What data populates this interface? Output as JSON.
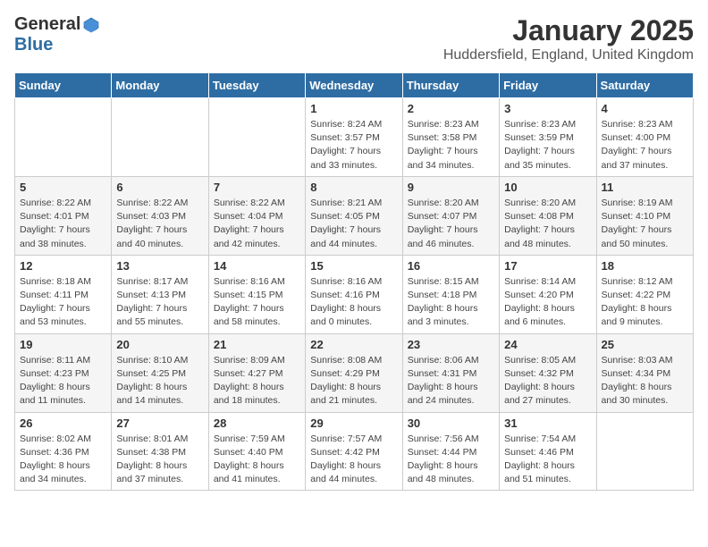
{
  "logo": {
    "general": "General",
    "blue": "Blue"
  },
  "title": {
    "month": "January 2025",
    "location": "Huddersfield, England, United Kingdom"
  },
  "days_of_week": [
    "Sunday",
    "Monday",
    "Tuesday",
    "Wednesday",
    "Thursday",
    "Friday",
    "Saturday"
  ],
  "weeks": [
    [
      {
        "day": "",
        "info": ""
      },
      {
        "day": "",
        "info": ""
      },
      {
        "day": "",
        "info": ""
      },
      {
        "day": "1",
        "info": "Sunrise: 8:24 AM\nSunset: 3:57 PM\nDaylight: 7 hours\nand 33 minutes."
      },
      {
        "day": "2",
        "info": "Sunrise: 8:23 AM\nSunset: 3:58 PM\nDaylight: 7 hours\nand 34 minutes."
      },
      {
        "day": "3",
        "info": "Sunrise: 8:23 AM\nSunset: 3:59 PM\nDaylight: 7 hours\nand 35 minutes."
      },
      {
        "day": "4",
        "info": "Sunrise: 8:23 AM\nSunset: 4:00 PM\nDaylight: 7 hours\nand 37 minutes."
      }
    ],
    [
      {
        "day": "5",
        "info": "Sunrise: 8:22 AM\nSunset: 4:01 PM\nDaylight: 7 hours\nand 38 minutes."
      },
      {
        "day": "6",
        "info": "Sunrise: 8:22 AM\nSunset: 4:03 PM\nDaylight: 7 hours\nand 40 minutes."
      },
      {
        "day": "7",
        "info": "Sunrise: 8:22 AM\nSunset: 4:04 PM\nDaylight: 7 hours\nand 42 minutes."
      },
      {
        "day": "8",
        "info": "Sunrise: 8:21 AM\nSunset: 4:05 PM\nDaylight: 7 hours\nand 44 minutes."
      },
      {
        "day": "9",
        "info": "Sunrise: 8:20 AM\nSunset: 4:07 PM\nDaylight: 7 hours\nand 46 minutes."
      },
      {
        "day": "10",
        "info": "Sunrise: 8:20 AM\nSunset: 4:08 PM\nDaylight: 7 hours\nand 48 minutes."
      },
      {
        "day": "11",
        "info": "Sunrise: 8:19 AM\nSunset: 4:10 PM\nDaylight: 7 hours\nand 50 minutes."
      }
    ],
    [
      {
        "day": "12",
        "info": "Sunrise: 8:18 AM\nSunset: 4:11 PM\nDaylight: 7 hours\nand 53 minutes."
      },
      {
        "day": "13",
        "info": "Sunrise: 8:17 AM\nSunset: 4:13 PM\nDaylight: 7 hours\nand 55 minutes."
      },
      {
        "day": "14",
        "info": "Sunrise: 8:16 AM\nSunset: 4:15 PM\nDaylight: 7 hours\nand 58 minutes."
      },
      {
        "day": "15",
        "info": "Sunrise: 8:16 AM\nSunset: 4:16 PM\nDaylight: 8 hours\nand 0 minutes."
      },
      {
        "day": "16",
        "info": "Sunrise: 8:15 AM\nSunset: 4:18 PM\nDaylight: 8 hours\nand 3 minutes."
      },
      {
        "day": "17",
        "info": "Sunrise: 8:14 AM\nSunset: 4:20 PM\nDaylight: 8 hours\nand 6 minutes."
      },
      {
        "day": "18",
        "info": "Sunrise: 8:12 AM\nSunset: 4:22 PM\nDaylight: 8 hours\nand 9 minutes."
      }
    ],
    [
      {
        "day": "19",
        "info": "Sunrise: 8:11 AM\nSunset: 4:23 PM\nDaylight: 8 hours\nand 11 minutes."
      },
      {
        "day": "20",
        "info": "Sunrise: 8:10 AM\nSunset: 4:25 PM\nDaylight: 8 hours\nand 14 minutes."
      },
      {
        "day": "21",
        "info": "Sunrise: 8:09 AM\nSunset: 4:27 PM\nDaylight: 8 hours\nand 18 minutes."
      },
      {
        "day": "22",
        "info": "Sunrise: 8:08 AM\nSunset: 4:29 PM\nDaylight: 8 hours\nand 21 minutes."
      },
      {
        "day": "23",
        "info": "Sunrise: 8:06 AM\nSunset: 4:31 PM\nDaylight: 8 hours\nand 24 minutes."
      },
      {
        "day": "24",
        "info": "Sunrise: 8:05 AM\nSunset: 4:32 PM\nDaylight: 8 hours\nand 27 minutes."
      },
      {
        "day": "25",
        "info": "Sunrise: 8:03 AM\nSunset: 4:34 PM\nDaylight: 8 hours\nand 30 minutes."
      }
    ],
    [
      {
        "day": "26",
        "info": "Sunrise: 8:02 AM\nSunset: 4:36 PM\nDaylight: 8 hours\nand 34 minutes."
      },
      {
        "day": "27",
        "info": "Sunrise: 8:01 AM\nSunset: 4:38 PM\nDaylight: 8 hours\nand 37 minutes."
      },
      {
        "day": "28",
        "info": "Sunrise: 7:59 AM\nSunset: 4:40 PM\nDaylight: 8 hours\nand 41 minutes."
      },
      {
        "day": "29",
        "info": "Sunrise: 7:57 AM\nSunset: 4:42 PM\nDaylight: 8 hours\nand 44 minutes."
      },
      {
        "day": "30",
        "info": "Sunrise: 7:56 AM\nSunset: 4:44 PM\nDaylight: 8 hours\nand 48 minutes."
      },
      {
        "day": "31",
        "info": "Sunrise: 7:54 AM\nSunset: 4:46 PM\nDaylight: 8 hours\nand 51 minutes."
      },
      {
        "day": "",
        "info": ""
      }
    ]
  ]
}
